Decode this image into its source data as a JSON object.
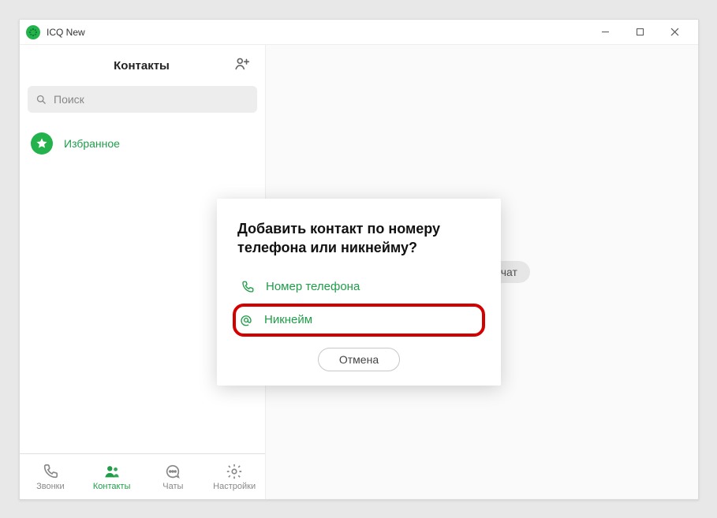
{
  "window": {
    "title": "ICQ New"
  },
  "sidebar": {
    "title": "Контакты",
    "search_placeholder": "Поиск",
    "favorites_label": "Избранное"
  },
  "nav": {
    "calls": "Звонки",
    "contacts": "Контакты",
    "chats": "Чаты",
    "settings": "Настройки"
  },
  "main": {
    "empty_hint": "Выберите чат"
  },
  "modal": {
    "title": "Добавить контакт по номеру телефона или никнейму?",
    "option_phone": "Номер телефона",
    "option_nickname": "Никнейм",
    "cancel": "Отмена"
  },
  "colors": {
    "accent": "#1f9d49",
    "highlight": "#d30000"
  }
}
